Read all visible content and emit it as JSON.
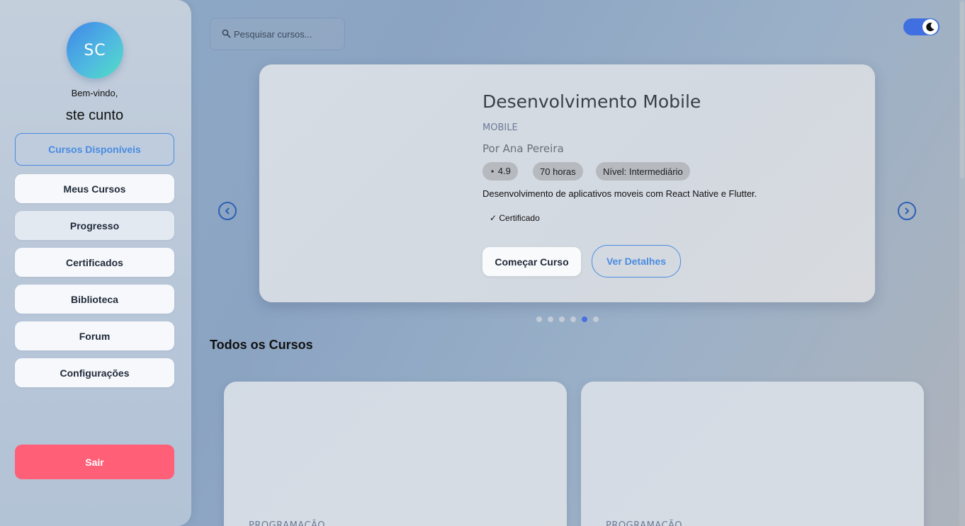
{
  "sidebar": {
    "avatar_initials": "SC",
    "welcome": "Bem-vindo,",
    "username": "ste cunto",
    "items": [
      {
        "label": "Cursos Disponíveis"
      },
      {
        "label": "Meus Cursos"
      },
      {
        "label": "Progresso"
      },
      {
        "label": "Certificados"
      },
      {
        "label": "Biblioteca"
      },
      {
        "label": "Forum"
      },
      {
        "label": "Configurações"
      }
    ],
    "logout_label": "Sair"
  },
  "search": {
    "placeholder": "Pesquisar cursos..."
  },
  "theme_toggle": {
    "state": "dark-mode-on",
    "accent": "#3f6fe0"
  },
  "featured": {
    "title": "Desenvolvimento Mobile",
    "category": "MOBILE",
    "author": "Por Ana Pereira",
    "rating": "⋆ 4.9",
    "duration": "70 horas",
    "level": "Nível: Intermediário",
    "description": "Desenvolvimento de aplicativos moveis com React Native e Flutter.",
    "certificate": "✓ Certificado",
    "start_label": "Começar Curso",
    "details_label": "Ver Detalhes"
  },
  "carousel": {
    "slide_count": 6,
    "active_index": 4
  },
  "all_courses": {
    "title": "Todos os Cursos",
    "cards": [
      {
        "category": "PROGRAMAÇÃO"
      },
      {
        "category": "PROGRAMAÇÃO"
      }
    ]
  },
  "colors": {
    "accent": "#4a8be0",
    "logout": "#ff5f77"
  }
}
